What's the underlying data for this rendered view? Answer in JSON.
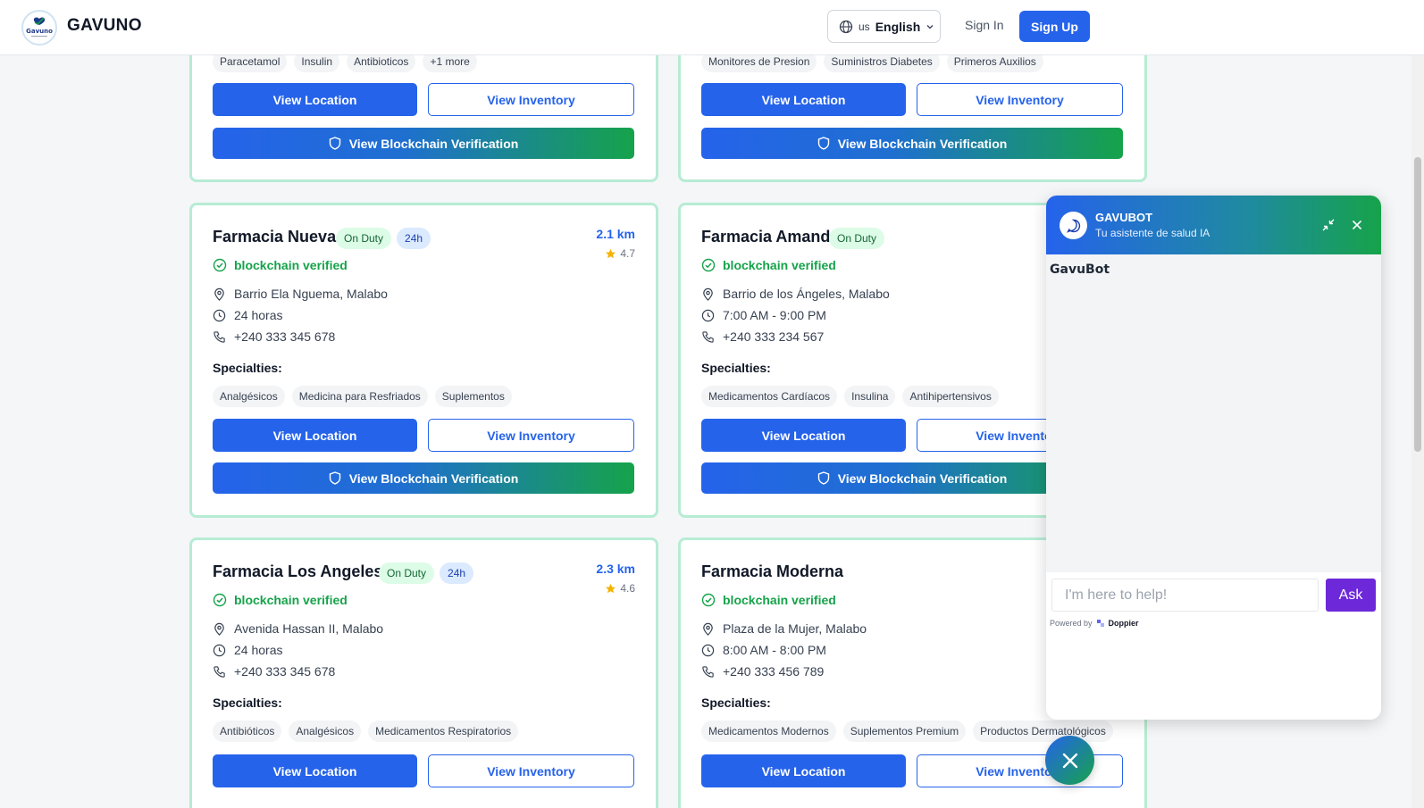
{
  "header": {
    "brand": "GAVUNO",
    "logo_text": "Gavuno",
    "language_code": "us",
    "language": "English",
    "signin": "Sign In",
    "signup": "Sign Up"
  },
  "colors": {
    "primary": "#2563eb",
    "success": "#16a34a",
    "card_border": "#b7ecd4",
    "chat_button": "#6d28d9"
  },
  "labels": {
    "verified": "blockchain verified",
    "specialties": "Specialties:",
    "view_location": "View Location",
    "view_inventory": "View Inventory",
    "view_blockchain": "View Blockchain Verification"
  },
  "top_cards": [
    {
      "chips": [
        "Paracetamol",
        "Insulin",
        "Antibioticos",
        "+1 more"
      ]
    },
    {
      "chips": [
        "Monitores de Presion",
        "Suministros Diabetes",
        "Primeros Auxilios"
      ]
    }
  ],
  "pharmacies": [
    {
      "name": "Farmacia Nueva",
      "on_duty": "On Duty",
      "badge_24h": "24h",
      "distance": "2.1 km",
      "rating": "4.7",
      "address": "Barrio Ela Nguema, Malabo",
      "hours": "24 horas",
      "phone": "+240 333 345 678",
      "specialties": [
        "Analgésicos",
        "Medicina para Resfriados",
        "Suplementos"
      ]
    },
    {
      "name": "Farmacia Amanda",
      "on_duty": "On Duty",
      "badge_24h": "",
      "distance": "",
      "rating": "",
      "address": "Barrio de los Ángeles, Malabo",
      "hours": "7:00 AM - 9:00 PM",
      "phone": "+240 333 234 567",
      "specialties": [
        "Medicamentos Cardíacos",
        "Insulina",
        "Antihipertensivos"
      ]
    },
    {
      "name": "Farmacia Los Angeles",
      "on_duty": "On Duty",
      "badge_24h": "24h",
      "distance": "2.3 km",
      "rating": "4.6",
      "address": "Avenida Hassan II, Malabo",
      "hours": "24 horas",
      "phone": "+240 333 345 678",
      "specialties": [
        "Antibióticos",
        "Analgésicos",
        "Medicamentos Respiratorios"
      ]
    },
    {
      "name": "Farmacia Moderna",
      "on_duty": "",
      "badge_24h": "",
      "distance": "",
      "rating": "",
      "address": "Plaza de la Mujer, Malabo",
      "hours": "8:00 AM - 8:00 PM",
      "phone": "+240 333 456 789",
      "specialties": [
        "Medicamentos Modernos",
        "Suplementos Premium",
        "Productos Dermatológicos"
      ]
    }
  ],
  "chat": {
    "title": "GAVUBOT",
    "subtitle": "Tu asistente de salud IA",
    "bot_name": "GavuBot",
    "input_placeholder": "I'm here to help!",
    "ask_label": "Ask",
    "powered_by": "Powered by",
    "powered_brand": "Doppier"
  }
}
